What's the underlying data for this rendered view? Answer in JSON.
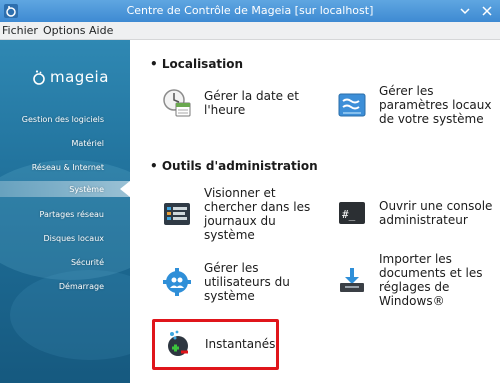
{
  "window": {
    "title": "Centre de Contrôle de Mageia [sur localhost]",
    "minimize_icon": "chevron-down-icon",
    "close_icon": "close-icon"
  },
  "menubar": {
    "items": [
      "Fichier",
      "Options",
      "Aide"
    ]
  },
  "sidebar": {
    "logo_text": "mageia",
    "items": [
      "Gestion des logiciels",
      "Matériel",
      "Réseau & Internet",
      "Système",
      "Partages réseau",
      "Disques locaux",
      "Sécurité",
      "Démarrage"
    ],
    "selected": "Système"
  },
  "main": {
    "sections": [
      {
        "title": "• Localisation",
        "entries": [
          {
            "label": "Gérer la date et l'heure",
            "icon": "clock-calendar-icon"
          },
          {
            "label": "Gérer les paramètres locaux de votre système",
            "icon": "locale-flag-icon"
          }
        ]
      },
      {
        "title": "• Outils d'administration",
        "entries": [
          {
            "label": "Visionner et chercher dans les journaux du système",
            "icon": "log-viewer-icon"
          },
          {
            "label": "Ouvrir une console administrateur",
            "icon": "terminal-icon"
          },
          {
            "label": "Gérer les utilisateurs du système",
            "icon": "users-gear-icon"
          },
          {
            "label": "Importer les documents et les réglages de Windows®",
            "icon": "import-download-icon"
          },
          {
            "label": "Instantanés",
            "icon": "snapshots-icon"
          }
        ]
      }
    ]
  },
  "colors": {
    "titlebar": "#4a95d8",
    "sidebar": "#1f6f99",
    "highlight": "#e0151b"
  }
}
